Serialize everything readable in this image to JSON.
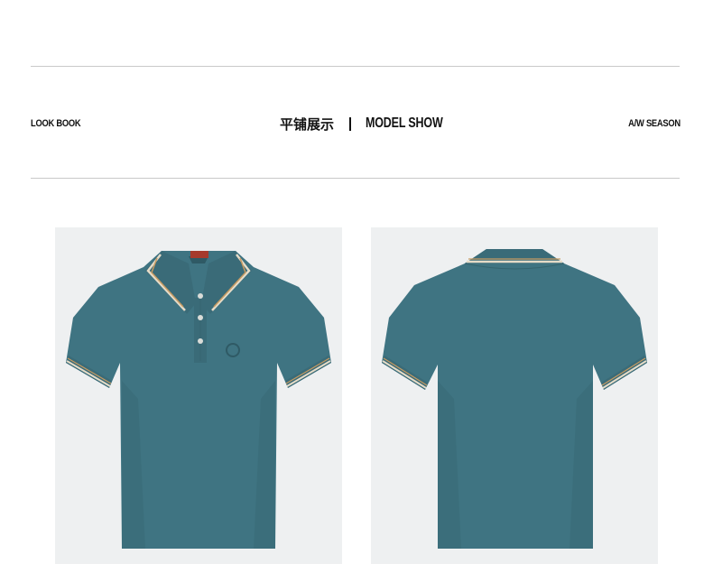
{
  "header": {
    "left_label": "LOOK BOOK",
    "title_cn": "平铺展示",
    "title_en": "MODEL SHOW",
    "right_label": "A/W SEASON"
  },
  "products": [
    {
      "view": "front",
      "icon": "polo-shirt-front-image",
      "color": "#3f7482"
    },
    {
      "view": "back",
      "icon": "polo-shirt-back-image",
      "color": "#3f7482"
    }
  ],
  "colors": {
    "shirt": "#3f7482",
    "shirt_shadow": "#35656f",
    "trim_cream": "#e6dcc8",
    "trim_tan": "#c79b62",
    "rule": "#c9c9c9",
    "photo_bg": "#eef0f1"
  }
}
